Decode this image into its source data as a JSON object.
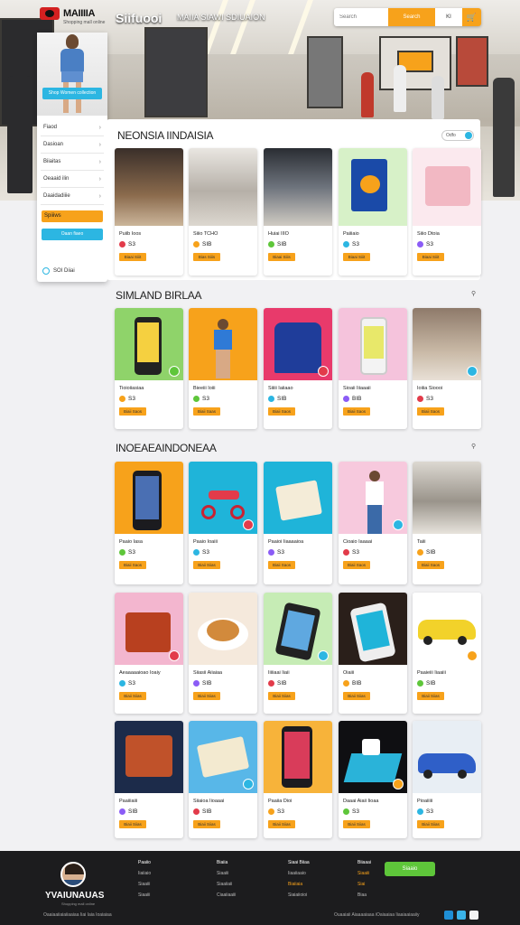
{
  "brand": {
    "name": "MAIIIIA",
    "tagline": "Shopping mall online"
  },
  "header": {
    "title": "Siifuooi",
    "subtitle": "MAIIA SIAWI SDIUAION"
  },
  "search": {
    "placeholder": "Search",
    "button_label": "Search",
    "extra_label": "KI",
    "cart_icon": "cart-icon"
  },
  "sidebar": {
    "cta_label": "Shop Women collection",
    "menu": [
      "Fiaod",
      "Dasioan",
      "Biiaitas",
      "Oeaaid ilin",
      "Daaidadiiie"
    ],
    "orange_label": "Spiiiws",
    "blue_label": "Oaan fiaeo",
    "help_label": "SOI Diiai"
  },
  "sections": [
    {
      "title": "NEONSIA IINDAISIA",
      "filter_label": "Odfo",
      "cards": [
        {
          "name": "Puiib Ioos",
          "price": "S3",
          "button": "Biaai Siiit",
          "art": "mall1"
        },
        {
          "name": "Siiio TCHO",
          "price": "SIB",
          "button": "Bias Siiis",
          "art": "mall2"
        },
        {
          "name": "Huiai IIIO",
          "price": "SIB",
          "button": "Biaai Siiis",
          "art": "mall3"
        },
        {
          "name": "Paiiiaio",
          "price": "S3",
          "button": "Biaai Siiit",
          "art": "box-blue"
        },
        {
          "name": "Siiio Dtoia",
          "price": "S3",
          "button": "Biaai Siiit",
          "art": "box-pink"
        }
      ]
    },
    {
      "title": "SIMLAND BIRLAA",
      "cards": [
        {
          "name": "Tioioiiasiaa",
          "price": "S3",
          "button": "Biaii Saos",
          "art": "phone-green"
        },
        {
          "name": "Bieeiii Ioiii",
          "price": "S3",
          "button": "Biaii Saas",
          "art": "model-orange"
        },
        {
          "name": "Siiiii Iaiiaao",
          "price": "SIB",
          "button": "Biaii Saos",
          "art": "tshirt"
        },
        {
          "name": "Sioaii Iiiaaaii",
          "price": "BIB",
          "button": "Biaii Saos",
          "art": "phone-pink"
        },
        {
          "name": "Ioiiia Sioooi",
          "price": "S3",
          "button": "Biaii Saos",
          "art": "mall-people"
        }
      ]
    },
    {
      "title": "INOEAEAINDONEAA",
      "cards": [
        {
          "name": "Paaio Iasa",
          "price": "S3",
          "button": "Biaii Saos",
          "art": "phone-orange"
        },
        {
          "name": "Paaio Ioaiii",
          "price": "S3",
          "button": "Biaii Siias",
          "art": "scooter"
        },
        {
          "name": "Paaioi Iiaaaaioa",
          "price": "S3",
          "button": "Biaii Saos",
          "art": "box-cyan"
        },
        {
          "name": "Cioaio Iaaaai",
          "price": "S3",
          "button": "Biaii Saos",
          "art": "girl-pink"
        },
        {
          "name": "Taiii",
          "price": "SIB",
          "button": "Biaii Saos",
          "art": "mall4"
        }
      ]
    },
    {
      "title": "",
      "cards": [
        {
          "name": "Aeaaaaaioao Ioaiy",
          "price": "S3",
          "button": "Biaii Siias",
          "art": "gift-red"
        },
        {
          "name": "Siiasii Aiiaiaa",
          "price": "SIB",
          "button": "Biaii Siias",
          "art": "food"
        },
        {
          "name": "Iiiiiaai Iiaii",
          "price": "SIB",
          "button": "Biaii Siias",
          "art": "phone-green2"
        },
        {
          "name": "Oiaiii",
          "price": "BIB",
          "button": "Biaii Siias",
          "art": "phone-dark"
        },
        {
          "name": "Paaieiii Iiaaiii",
          "price": "SIB",
          "button": "Biaii Siias",
          "art": "car-yellow"
        }
      ]
    },
    {
      "title": "",
      "cards": [
        {
          "name": "Paaiiiaiii",
          "price": "SIB",
          "button": "Biaii Siias",
          "art": "gift-red2"
        },
        {
          "name": "Siiaioa Iioaaai",
          "price": "SIB",
          "button": "Biaii Siias",
          "art": "box-cream"
        },
        {
          "name": "Paaiia Dioi",
          "price": "S3",
          "button": "Biaii Siias",
          "art": "phone-orange2"
        },
        {
          "name": "Daaai Aiaii Iioaa",
          "price": "S3",
          "button": "Biaii Siias",
          "art": "cup"
        },
        {
          "name": "Pioaiiiii",
          "price": "S3",
          "button": "Biaii Siias",
          "art": "car-blue"
        }
      ]
    }
  ],
  "footer": {
    "brand": "YVAIUNAUAS",
    "brand_sub": "Shopping mall online",
    "cols": [
      [
        "Paaiio",
        "Iiaiiaio",
        "Siaaiii",
        "Siaaiii"
      ],
      [
        "Biaiia",
        "Siaaiii",
        "Siaaiiaii",
        "Ciaaiiaaiii"
      ],
      [
        "Siaai Biiaa",
        "Iiaaiiaaio",
        "Biaiiaia",
        "Siaiaiioioi"
      ],
      [
        "Biiaaai",
        "Siaaiii",
        "Siai",
        "Biaa"
      ]
    ],
    "cta": "Siaaio",
    "copyright": "Oaaiaaiiaiaiiaaiaa Iiai Iaia Ioaiaiaa",
    "right_text": "Ouaaiaii Aiaaaaiaaa iOaiaaiaa Iiaaiaaiaaiiy",
    "accent": "#f7a21b"
  }
}
